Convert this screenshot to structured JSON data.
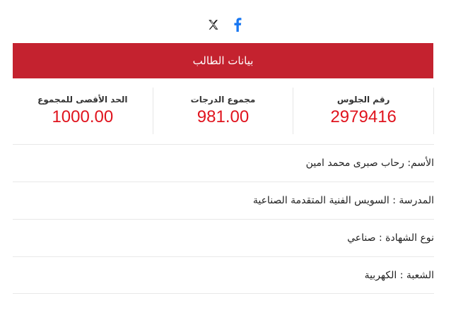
{
  "share": {
    "x_icon": "x-twitter-icon",
    "facebook_icon": "facebook-icon",
    "facebook_color": "#1877f2"
  },
  "banner": {
    "title": "بيانات الطالب",
    "color": "#c4222f"
  },
  "stats": [
    {
      "label": "رقم الجلوس",
      "value": "2979416"
    },
    {
      "label": "مجموع الدرجات",
      "value": "981.00"
    },
    {
      "label": "الحد الأقصى للمجموع",
      "value": "1000.00"
    }
  ],
  "details": [
    {
      "text": "الأسم: رحاب صبرى محمد امين"
    },
    {
      "text": "المدرسة : السويس الفنية المتقدمة الصناعية"
    },
    {
      "text": "نوع الشهادة : صناعي"
    },
    {
      "text": "الشعبة : الكهربية"
    }
  ],
  "accent_value_color": "#e0141e"
}
